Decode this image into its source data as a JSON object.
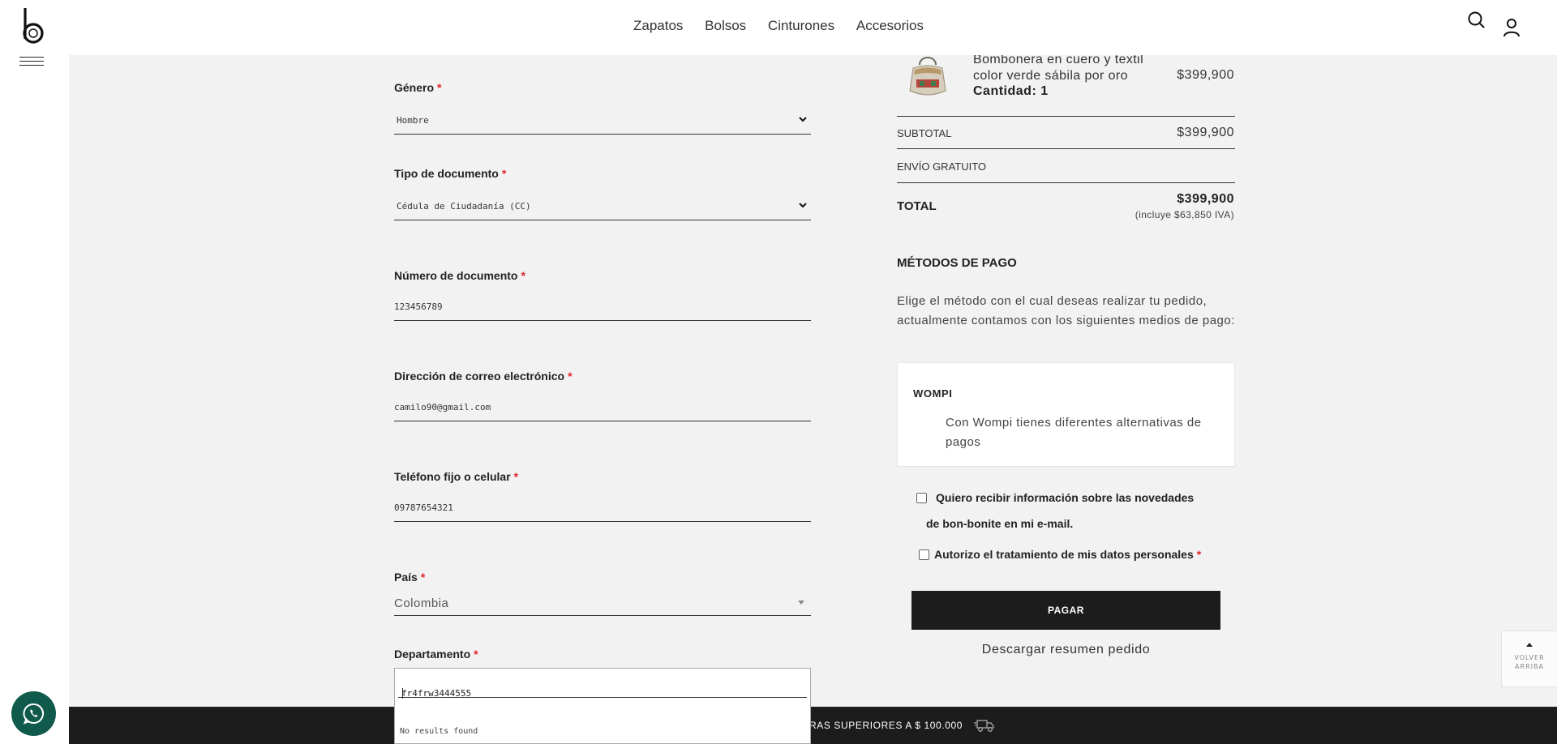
{
  "nav": {
    "items": [
      "Zapatos",
      "Bolsos",
      "Cinturones",
      "Accesorios"
    ]
  },
  "icons": {
    "logo": "bon-bonite-logo",
    "menu": "hamburger-menu-icon",
    "search": "search-icon",
    "account": "user-icon",
    "whatsapp": "whatsapp-icon",
    "shipping": "truck-icon"
  },
  "form": {
    "required_mark": "*",
    "genero": {
      "label": "Género",
      "value": "Hombre"
    },
    "tipo_documento": {
      "label": "Tipo de documento",
      "value": "Cédula de Ciudadanía (CC)"
    },
    "numero_documento": {
      "label": "Número de documento",
      "value": "123456789"
    },
    "email": {
      "label": "Dirección de correo electrónico",
      "value": "camilo90@gmail.com"
    },
    "telefono": {
      "label": "Teléfono fijo o celular",
      "value": "09787654321"
    },
    "pais": {
      "label": "País",
      "value": "Colombia"
    },
    "departamento": {
      "label": "Departamento",
      "search_value": "fr4frw3444555",
      "no_results": "No results found"
    }
  },
  "summary": {
    "product": {
      "name": "Bombonera en cuero y textil color verde sábila por oro",
      "quantity": "Cantidad: 1",
      "price": "$399,900"
    },
    "subtotal_label": "SUBTOTAL",
    "subtotal_value": "$399,900",
    "shipping_label": "ENVÍO GRATUITO",
    "total_label": "TOTAL",
    "total_value": "$399,900",
    "total_note": "(incluye $63,850 IVA)"
  },
  "payment": {
    "title": "MÉTODOS DE PAGO",
    "description": "Elige el método con el cual deseas realizar tu pedido, actualmente contamos con los siguientes medios de pago:",
    "method_name": "WOMPI",
    "method_desc": "Con Wompi tienes diferentes alternativas de pagos",
    "newsletter_label": "Quiero recibir información sobre las novedades de bon-bonite en mi e-mail.",
    "privacy_label": "Autorizo el tratamiento de mis datos personales",
    "pay_button": "PAGAR",
    "download_link": "Descargar resumen pedido"
  },
  "back_to_top": {
    "line1": "VOLVER",
    "line2": "ARRIBA"
  },
  "banner": {
    "text": "RAS SUPERIORES A $ 100.000"
  },
  "colors": {
    "required": "#e1262d",
    "dark": "#1c1c1c",
    "background": "#f2f2f2",
    "whatsapp": "#0f5a4a"
  }
}
